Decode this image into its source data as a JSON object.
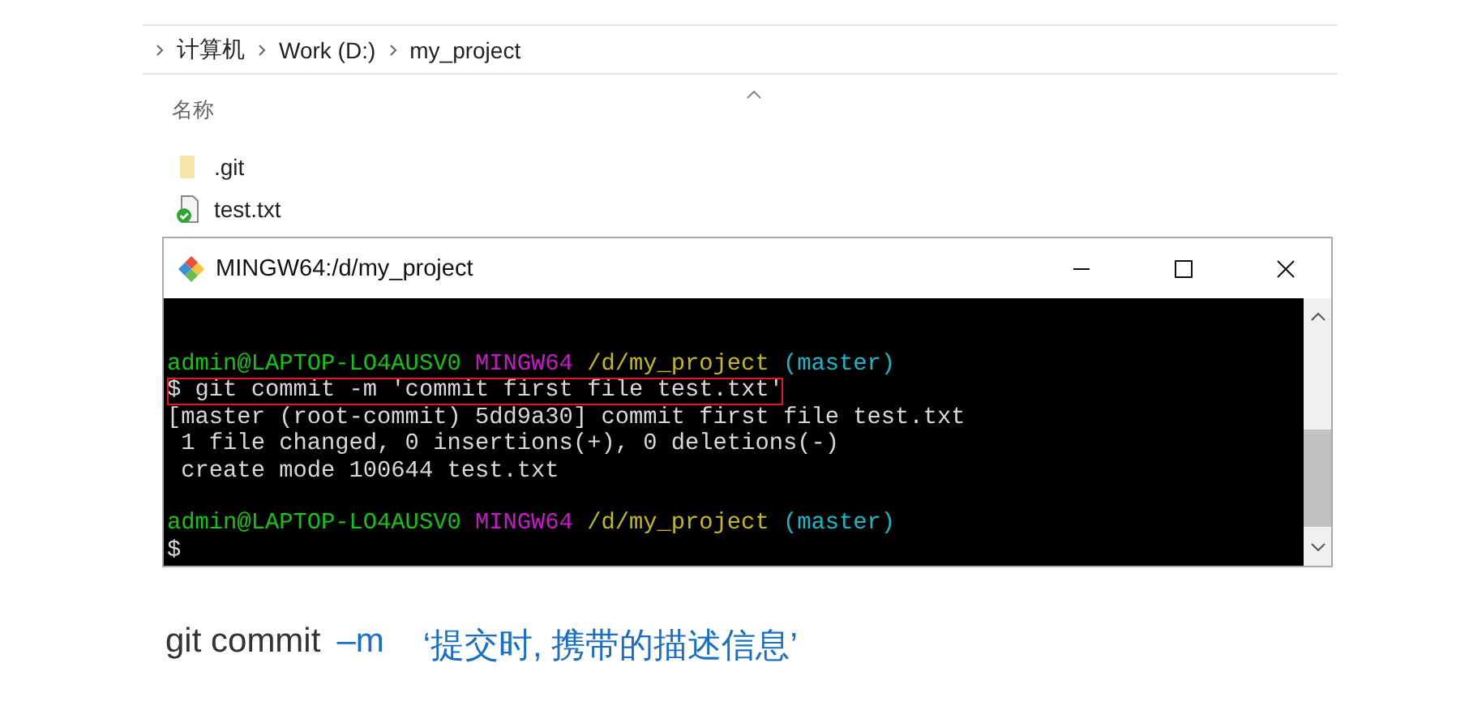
{
  "explorer": {
    "breadcrumb": [
      "计算机",
      "Work (D:)",
      "my_project"
    ],
    "column_header": "名称",
    "files": [
      {
        "name": ".git",
        "kind": "folder"
      },
      {
        "name": "test.txt",
        "kind": "tracked_file"
      }
    ]
  },
  "terminal": {
    "title": "MINGW64:/d/my_project",
    "window_buttons": [
      {
        "kind": "minimize"
      },
      {
        "kind": "maximize"
      },
      {
        "kind": "close"
      }
    ],
    "lines": [
      {
        "gap_before": false,
        "highlighted": false,
        "segments": [
          {
            "text": "admin@LAPTOP-LO4AUSV0",
            "color": "#13c413"
          },
          {
            "text": "MINGW64",
            "color": "#c61ac6"
          },
          {
            "text": "/d/my_project",
            "color": "#c4b81a"
          },
          {
            "text": "(master)",
            "color": "#1ab8c4"
          }
        ]
      },
      {
        "gap_before": false,
        "highlighted": true,
        "segments": [
          {
            "text": "$ git commit -m 'commit first file test.txt'",
            "color": "#d8d8d8"
          }
        ]
      },
      {
        "gap_before": false,
        "highlighted": false,
        "segments": [
          {
            "text": "[master (root-commit) 5dd9a30] commit first file test.txt",
            "color": "#d8d8d8"
          }
        ]
      },
      {
        "gap_before": false,
        "highlighted": false,
        "segments": [
          {
            "text": " 1 file changed, 0 insertions(+), 0 deletions(-)",
            "color": "#d8d8d8"
          }
        ]
      },
      {
        "gap_before": false,
        "highlighted": false,
        "segments": [
          {
            "text": " create mode 100644 test.txt",
            "color": "#d8d8d8"
          }
        ]
      },
      {
        "gap_before": true,
        "highlighted": false,
        "segments": [
          {
            "text": "admin@LAPTOP-LO4AUSV0",
            "color": "#13c413"
          },
          {
            "text": "MINGW64",
            "color": "#c61ac6"
          },
          {
            "text": "/d/my_project",
            "color": "#c4b81a"
          },
          {
            "text": "(master)",
            "color": "#1ab8c4"
          }
        ]
      },
      {
        "gap_before": false,
        "highlighted": false,
        "segments": [
          {
            "text": "$",
            "color": "#d8d8d8"
          }
        ]
      }
    ]
  },
  "caption": [
    {
      "text": "git commit",
      "color": "#333333"
    },
    {
      "text": "–m",
      "color": "#1a6fc4"
    },
    {
      "text": "‘提交时, 携带的描述信息’",
      "color": "#1a6fc4"
    }
  ]
}
